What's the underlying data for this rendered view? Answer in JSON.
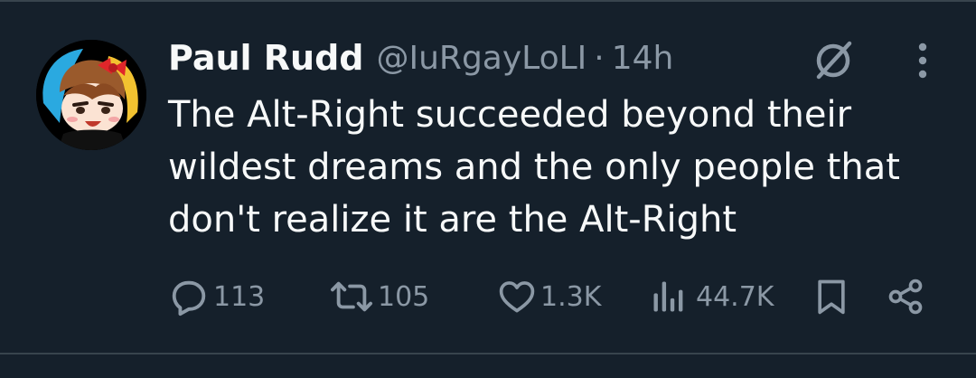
{
  "tweet": {
    "author_name": "Paul Rudd",
    "handle": "@IuRgayLoLI",
    "separator": "·",
    "time": "14h",
    "text": "The Alt-Right succeeded beyond their wildest dreams and the only people that don't realize it are the Alt-Right"
  },
  "actions": {
    "replies": "113",
    "reposts": "105",
    "likes": "1.3K",
    "views": "44.7K"
  },
  "icons": [
    "reply-icon",
    "repost-icon",
    "like-icon",
    "views-icon",
    "bookmark-icon",
    "share-icon",
    "grok-icon",
    "more-options-icon"
  ],
  "colors": {
    "background": "#15202b",
    "text_primary": "#f7f9f9",
    "text_secondary": "#8b98a5",
    "divider": "#38444d"
  }
}
